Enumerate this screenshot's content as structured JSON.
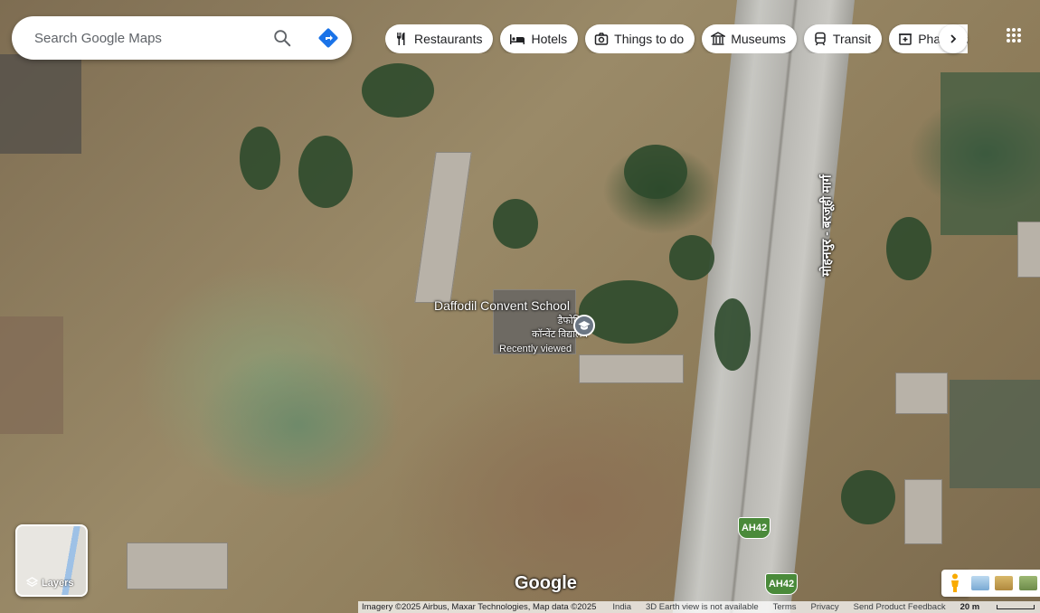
{
  "search": {
    "placeholder": "Search Google Maps"
  },
  "chips": [
    {
      "label": "Restaurants",
      "icon": "restaurant-icon"
    },
    {
      "label": "Hotels",
      "icon": "hotel-icon"
    },
    {
      "label": "Things to do",
      "icon": "camera-icon"
    },
    {
      "label": "Museums",
      "icon": "museum-icon"
    },
    {
      "label": "Transit",
      "icon": "transit-icon"
    },
    {
      "label": "Pharmacies",
      "icon": "pharmacy-icon"
    }
  ],
  "place": {
    "name": "Daffodil Convent School",
    "name_local": [
      "डैफोडिल",
      "कॉन्वेंट विद्यालय"
    ],
    "status": "Recently viewed",
    "icon": "school-icon"
  },
  "road": {
    "name": "मोहनपुर - बरजूही मार्ग",
    "shield": "AH42"
  },
  "layers": {
    "label": "Layers"
  },
  "brand": {
    "logo_text": "Google"
  },
  "footer": {
    "attribution": "Imagery ©2025 Airbus, Maxar Technologies, Map data ©2025",
    "links": [
      "India",
      "3D Earth view is not available",
      "Terms",
      "Privacy",
      "Send Product Feedback"
    ],
    "scale": "20 m"
  },
  "colors": {
    "accent": "#1a73e8",
    "shield": "#4a8a3a"
  }
}
